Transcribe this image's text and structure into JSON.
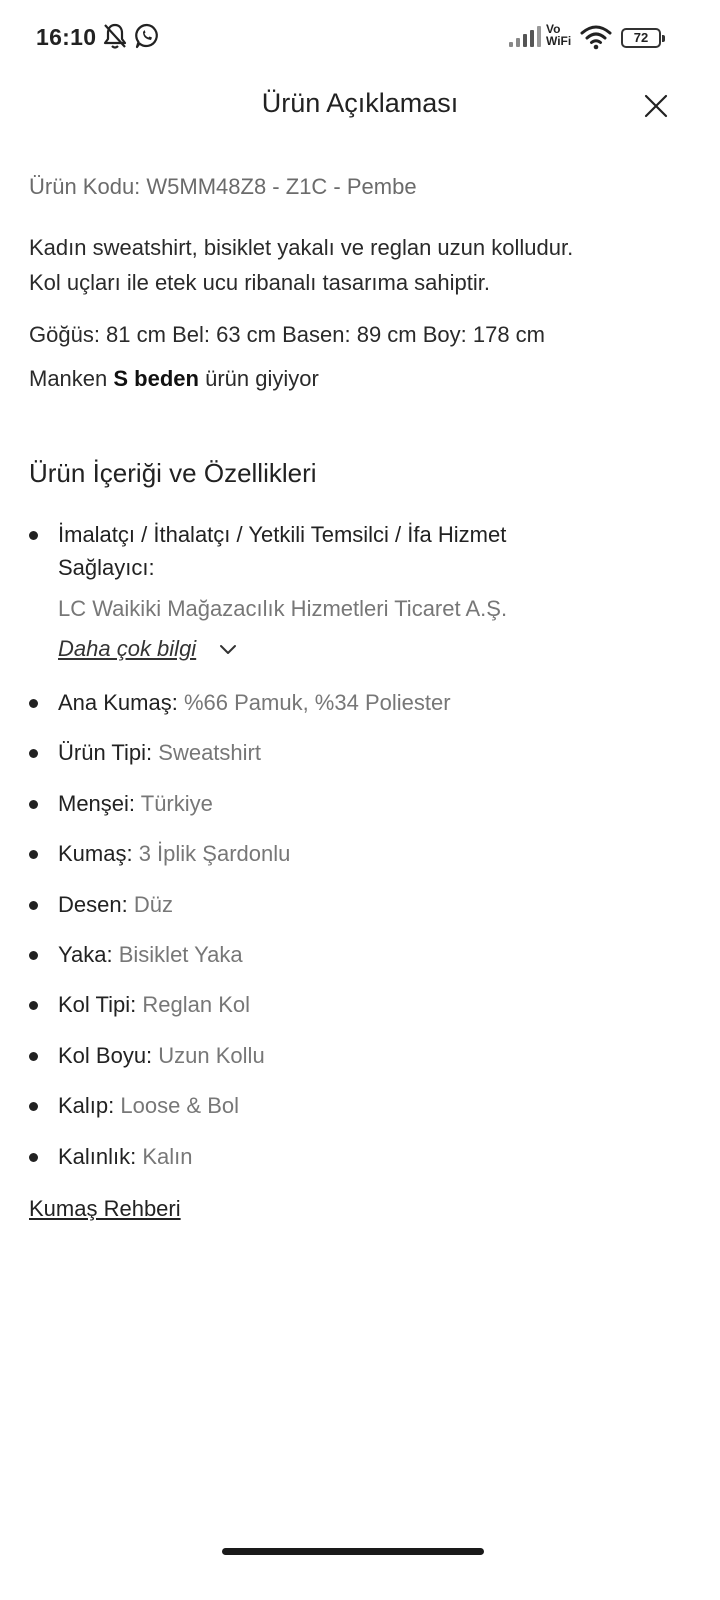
{
  "status_bar": {
    "time": "16:10",
    "vowifi_top": "Vo",
    "vowifi_bottom": "WiFi",
    "battery": "72",
    "icons": [
      "bell-off-icon",
      "whatsapp-icon",
      "signal-icon",
      "wifi-icon",
      "battery-icon"
    ]
  },
  "header": {
    "title": "Ürün Açıklaması",
    "close_icon": "close-icon"
  },
  "product": {
    "code_line": "Ürün Kodu: W5MM48Z8 - Z1C - Pembe",
    "description_line1": "Kadın sweatshirt, bisiklet yakalı ve reglan uzun kolludur.",
    "description_line2": "Kol uçları ile etek ucu ribanalı tasarıma sahiptir.",
    "measurements": "Göğüs: 81 cm Bel: 63 cm Basen: 89 cm Boy: 178 cm",
    "model_prefix": "Manken ",
    "model_size": "S beden",
    "model_suffix": " ürün giyiyor"
  },
  "section": {
    "title": "Ürün İçeriği ve Özellikleri",
    "manufacturer_label_line1": "İmalatçı / İthalatçı / Yetkili Temsilci / İfa Hizmet",
    "manufacturer_label_line2": "Sağlayıcı:",
    "manufacturer_value": "LC Waikiki Mağazacılık Hizmetleri Ticaret A.Ş.",
    "more_info": "Daha çok bilgi",
    "attributes": [
      {
        "key": "Ana Kumaş:",
        "value": " %66 Pamuk, %34 Poliester"
      },
      {
        "key": "Ürün Tipi:",
        "value": " Sweatshirt"
      },
      {
        "key": "Menşei:",
        "value": " Türkiye"
      },
      {
        "key": "Kumaş:",
        "value": " 3 İplik Şardonlu"
      },
      {
        "key": "Desen:",
        "value": " Düz"
      },
      {
        "key": "Yaka:",
        "value": " Bisiklet Yaka"
      },
      {
        "key": "Kol Tipi:",
        "value": " Reglan Kol"
      },
      {
        "key": "Kol Boyu:",
        "value": " Uzun Kollu"
      },
      {
        "key": "Kalıp:",
        "value": " Loose & Bol"
      },
      {
        "key": "Kalınlık:",
        "value": " Kalın"
      }
    ],
    "fabric_guide": "Kumaş Rehberi"
  }
}
